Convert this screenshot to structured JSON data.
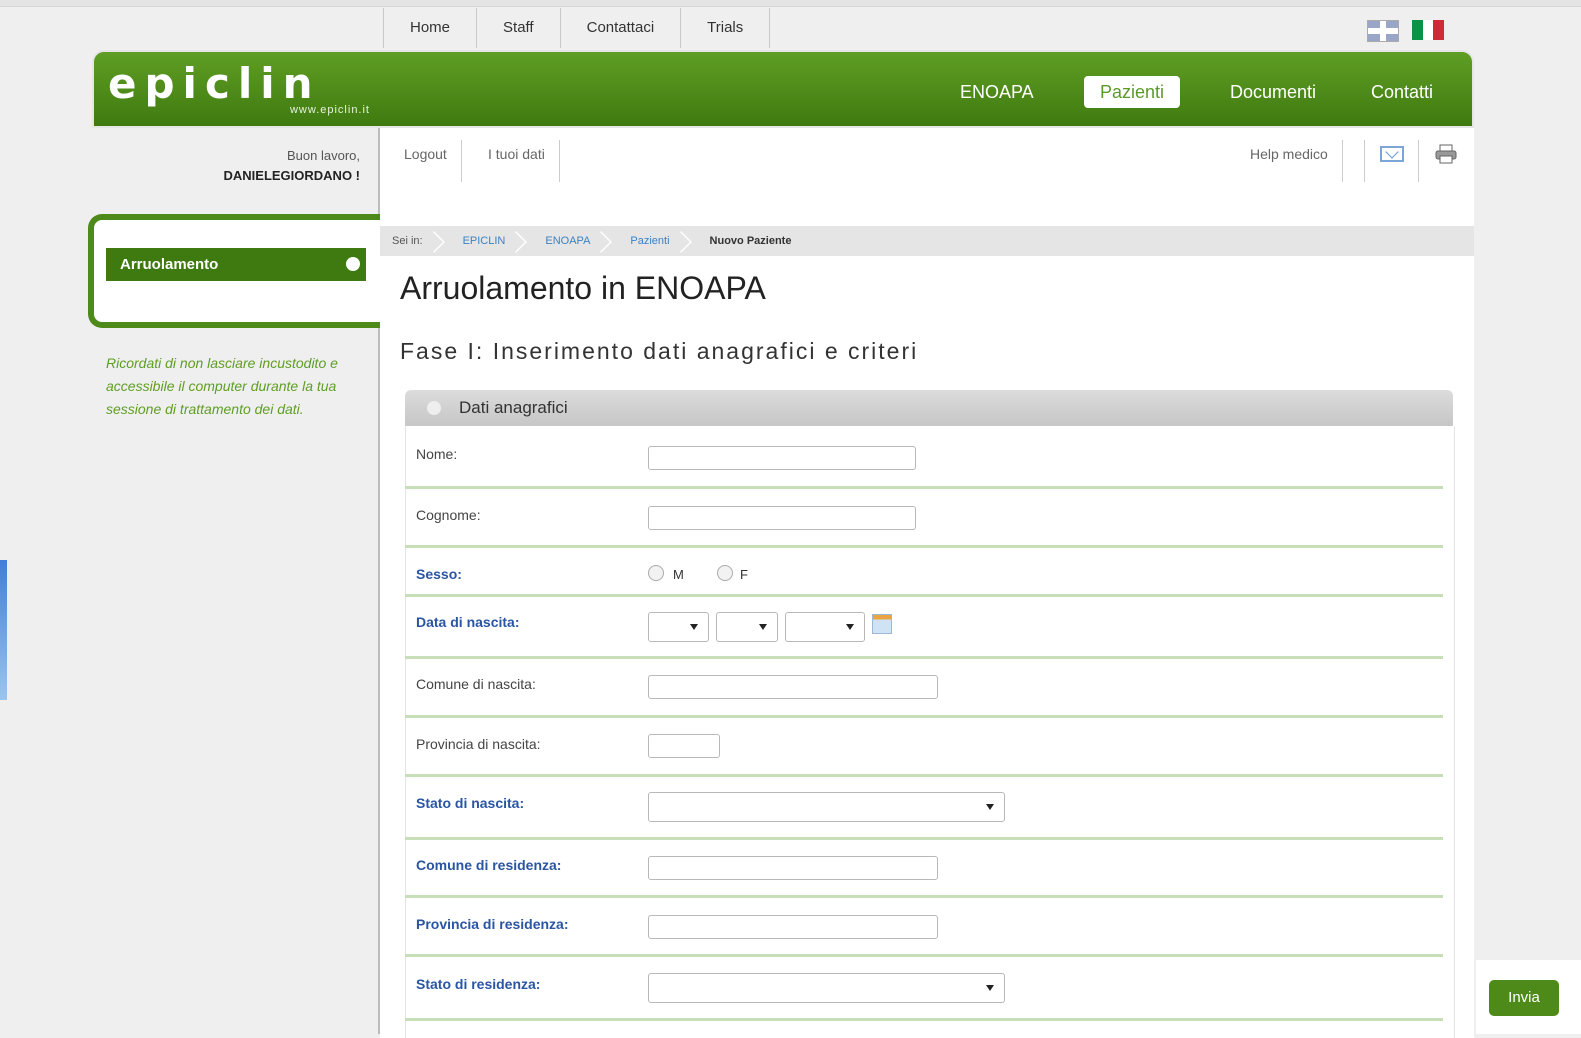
{
  "top_nav": [
    "Home",
    "Staff",
    "Contattaci",
    "Trials"
  ],
  "flags": {
    "uk": "uk-flag-icon",
    "it_colors": [
      "#0a9246",
      "#ffffff",
      "#ce2b37"
    ]
  },
  "logo": {
    "text": "epiclin",
    "url": "www.epiclin.it"
  },
  "main_nav": {
    "enoapa": "ENOAPA",
    "pazienti": "Pazienti",
    "documenti": "Documenti",
    "contatti": "Contatti"
  },
  "user": {
    "greeting": "Buon lavoro,",
    "name": "DANIELEGIORDANO !"
  },
  "sub_nav": {
    "logout": "Logout",
    "tuoi_dati": "I tuoi dati",
    "help": "Help medico"
  },
  "sidebar": {
    "item": "Arruolamento",
    "note": "Ricordati di non lasciare incustodito e accessibile il computer durante la tua sessione di trattamento dei dati."
  },
  "breadcrumb": {
    "label": "Sei in:",
    "items": [
      "EPICLIN",
      "ENOAPA",
      "Pazienti"
    ],
    "current": "Nuovo Paziente"
  },
  "page_title": "Arruolamento in ENOAPA",
  "phase_title": "Fase I: Inserimento dati anagrafici e criteri",
  "panel": {
    "title": "Dati anagrafici"
  },
  "form": {
    "nome": "Nome:",
    "cognome": "Cognome:",
    "sesso": "Sesso:",
    "sesso_m": "M",
    "sesso_f": "F",
    "data_nascita": "Data di nascita:",
    "comune_nascita": "Comune di nascita:",
    "provincia_nascita": "Provincia di nascita:",
    "stato_nascita": "Stato di nascita:",
    "comune_residenza": "Comune di residenza:",
    "provincia_residenza": "Provincia di residenza:",
    "stato_residenza": "Stato di residenza:"
  },
  "submit": "Invia",
  "colors": {
    "brand_green": "#4e8a19",
    "required_label": "#2a55a3",
    "link_blue": "#3b82c4"
  }
}
